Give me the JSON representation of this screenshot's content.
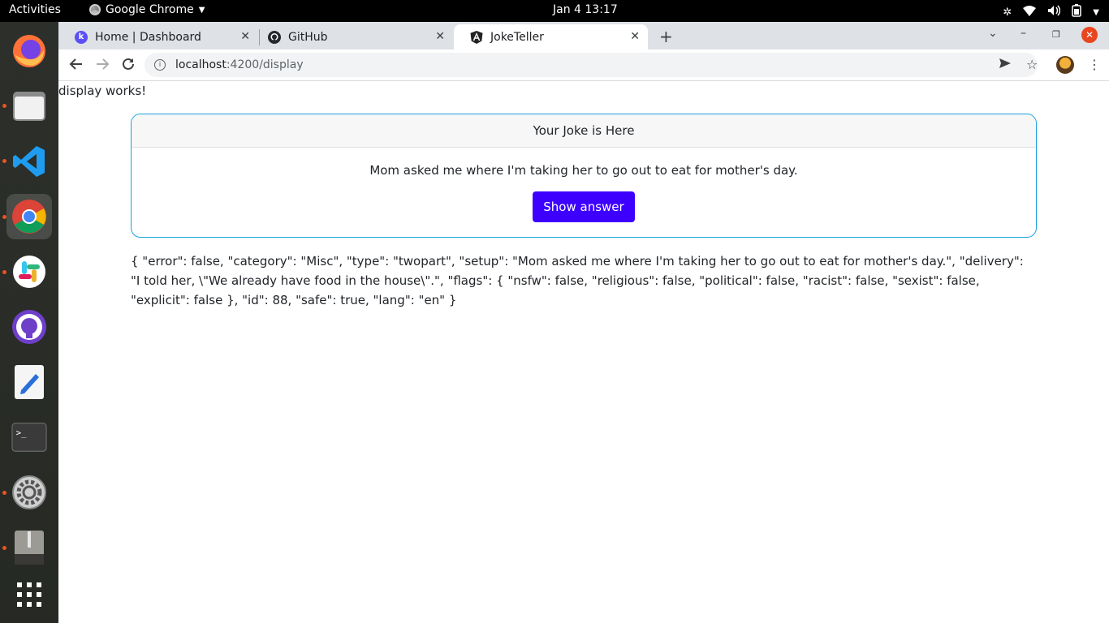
{
  "topbar": {
    "activities": "Activities",
    "app_name": "Google Chrome",
    "clock": "Jan 4  13:17"
  },
  "dock": {
    "items": [
      {
        "name": "firefox-icon"
      },
      {
        "name": "files-icon"
      },
      {
        "name": "vscode-icon"
      },
      {
        "name": "chrome-icon"
      },
      {
        "name": "slack-icon"
      },
      {
        "name": "github-desktop-icon"
      },
      {
        "name": "text-editor-icon"
      },
      {
        "name": "terminal-icon"
      },
      {
        "name": "settings-icon"
      },
      {
        "name": "archive-icon"
      },
      {
        "name": "show-apps-icon"
      }
    ]
  },
  "tabs": [
    {
      "title": "Home | Dashboard",
      "favicon": "k"
    },
    {
      "title": "GitHub",
      "favicon": "github"
    },
    {
      "title": "JokeTeller",
      "favicon": "angular",
      "active": true
    }
  ],
  "address": {
    "host": "localhost",
    "path": ":4200/display"
  },
  "page": {
    "heading": "display works!",
    "card": {
      "header": "Your Joke is Here",
      "setup": "Mom asked me where I'm taking her to go out to eat for mother's day.",
      "button_label": "Show answer"
    },
    "json_dump": "{ \"error\": false, \"category\": \"Misc\", \"type\": \"twopart\", \"setup\": \"Mom asked me where I'm taking her to go out to eat for mother's day.\", \"delivery\": \"I told her, \\\"We already have food in the house\\\".\", \"flags\": { \"nsfw\": false, \"religious\": false, \"political\": false, \"racist\": false, \"sexist\": false, \"explicit\": false }, \"id\": 88, \"safe\": true, \"lang\": \"en\" }"
  },
  "colors": {
    "accent_button": "#3d00ff",
    "card_border": "#17a2e0",
    "dock_running_dot": "#e95420"
  }
}
